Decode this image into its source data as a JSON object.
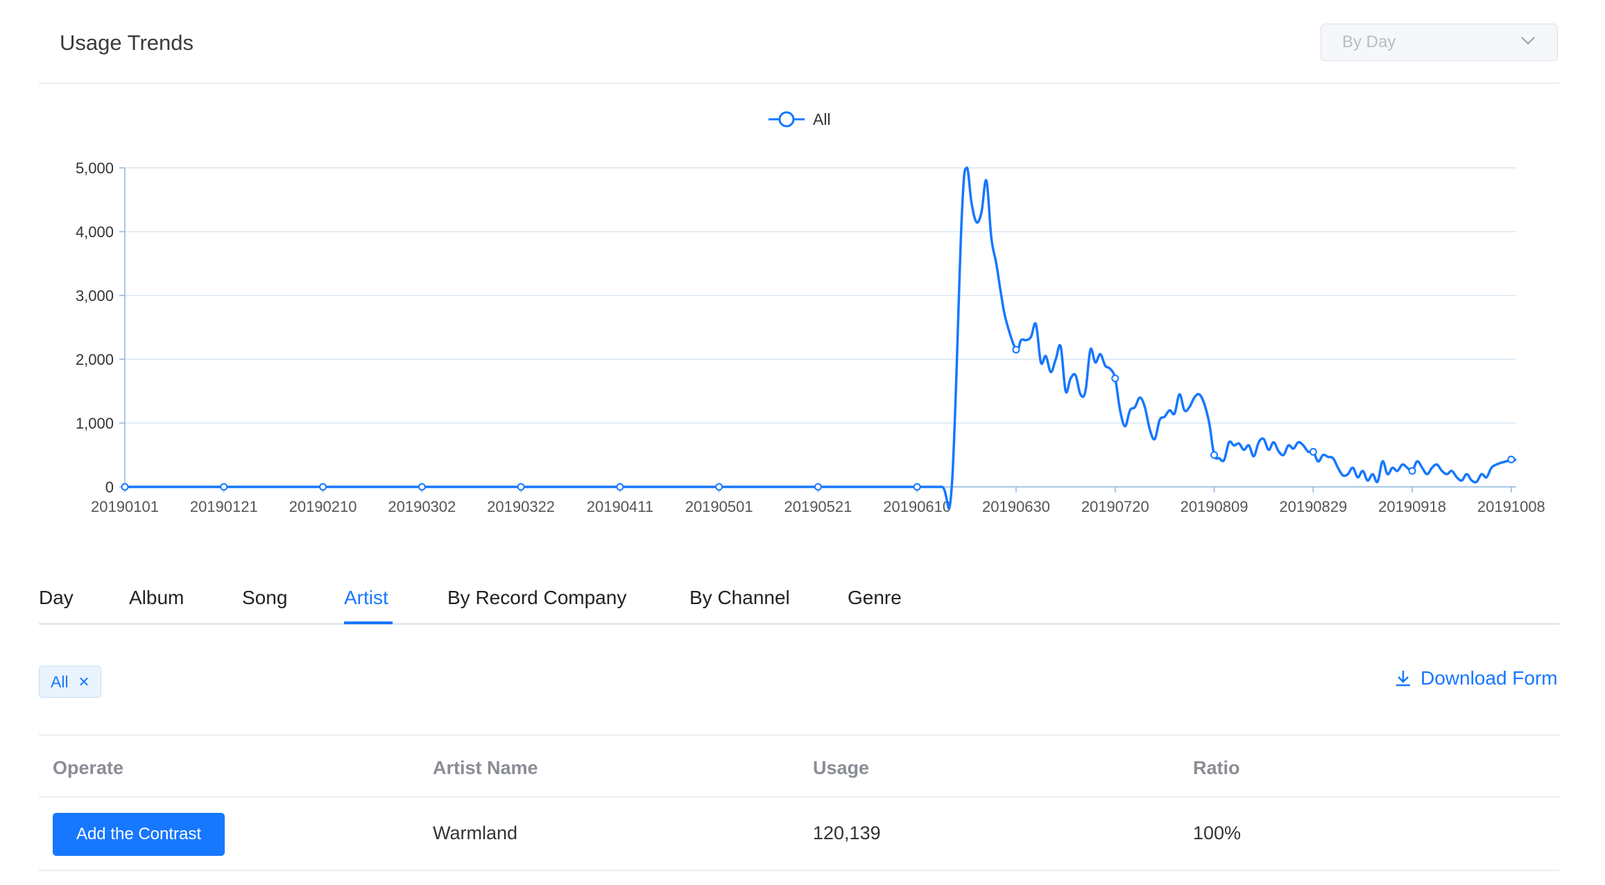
{
  "header": {
    "title": "Usage Trends",
    "period_select": {
      "value": "By Day",
      "icon": "chevron-down-icon"
    }
  },
  "chart_data": {
    "type": "line",
    "legend": [
      "All"
    ],
    "legend_position": "top-center",
    "series": [
      {
        "name": "All",
        "color": "#1677ff",
        "points": [
          [
            "20190101",
            0
          ],
          [
            "20190111",
            0
          ],
          [
            "20190121",
            0
          ],
          [
            "20190131",
            0
          ],
          [
            "20190210",
            0
          ],
          [
            "20190220",
            0
          ],
          [
            "20190302",
            0
          ],
          [
            "20190312",
            0
          ],
          [
            "20190322",
            0
          ],
          [
            "20190401",
            0
          ],
          [
            "20190411",
            0
          ],
          [
            "20190421",
            0
          ],
          [
            "20190501",
            0
          ],
          [
            "20190511",
            0
          ],
          [
            "20190521",
            0
          ],
          [
            "20190531",
            0
          ],
          [
            "20190610",
            0
          ],
          [
            "20190615",
            0
          ],
          [
            "20190617",
            0
          ],
          [
            "20190619",
            4200
          ],
          [
            "20190620",
            5000
          ],
          [
            "20190621",
            4450
          ],
          [
            "20190622",
            4150
          ],
          [
            "20190623",
            4300
          ],
          [
            "20190624",
            4800
          ],
          [
            "20190625",
            3900
          ],
          [
            "20190626",
            3500
          ],
          [
            "20190627",
            3000
          ],
          [
            "20190628",
            2600
          ],
          [
            "20190630",
            2150
          ],
          [
            "20190701",
            2300
          ],
          [
            "20190702",
            2300
          ],
          [
            "20190703",
            2350
          ],
          [
            "20190704",
            2550
          ],
          [
            "20190705",
            1950
          ],
          [
            "20190706",
            2050
          ],
          [
            "20190707",
            1800
          ],
          [
            "20190708",
            2000
          ],
          [
            "20190709",
            2200
          ],
          [
            "20190710",
            1500
          ],
          [
            "20190711",
            1700
          ],
          [
            "20190712",
            1750
          ],
          [
            "20190713",
            1450
          ],
          [
            "20190714",
            1500
          ],
          [
            "20190715",
            2150
          ],
          [
            "20190716",
            1950
          ],
          [
            "20190717",
            2080
          ],
          [
            "20190718",
            1900
          ],
          [
            "20190719",
            1850
          ],
          [
            "20190720",
            1700
          ],
          [
            "20190721",
            1200
          ],
          [
            "20190722",
            950
          ],
          [
            "20190723",
            1200
          ],
          [
            "20190724",
            1250
          ],
          [
            "20190725",
            1400
          ],
          [
            "20190726",
            1250
          ],
          [
            "20190727",
            900
          ],
          [
            "20190728",
            750
          ],
          [
            "20190729",
            1050
          ],
          [
            "20190730",
            1100
          ],
          [
            "20190731",
            1200
          ],
          [
            "20190801",
            1150
          ],
          [
            "20190802",
            1450
          ],
          [
            "20190803",
            1200
          ],
          [
            "20190804",
            1250
          ],
          [
            "20190805",
            1400
          ],
          [
            "20190806",
            1450
          ],
          [
            "20190807",
            1300
          ],
          [
            "20190808",
            1000
          ],
          [
            "20190809",
            500
          ],
          [
            "20190810",
            450
          ],
          [
            "20190811",
            420
          ],
          [
            "20190812",
            700
          ],
          [
            "20190813",
            650
          ],
          [
            "20190814",
            680
          ],
          [
            "20190815",
            580
          ],
          [
            "20190816",
            650
          ],
          [
            "20190817",
            480
          ],
          [
            "20190818",
            700
          ],
          [
            "20190819",
            750
          ],
          [
            "20190820",
            580
          ],
          [
            "20190821",
            700
          ],
          [
            "20190822",
            560
          ],
          [
            "20190823",
            500
          ],
          [
            "20190824",
            650
          ],
          [
            "20190825",
            600
          ],
          [
            "20190826",
            700
          ],
          [
            "20190827",
            650
          ],
          [
            "20190828",
            550
          ],
          [
            "20190829",
            550
          ],
          [
            "20190830",
            400
          ],
          [
            "20190831",
            500
          ],
          [
            "20190901",
            470
          ],
          [
            "20190902",
            450
          ],
          [
            "20190903",
            300
          ],
          [
            "20190904",
            180
          ],
          [
            "20190905",
            200
          ],
          [
            "20190906",
            300
          ],
          [
            "20190907",
            150
          ],
          [
            "20190908",
            250
          ],
          [
            "20190909",
            100
          ],
          [
            "20190910",
            200
          ],
          [
            "20190911",
            80
          ],
          [
            "20190912",
            400
          ],
          [
            "20190913",
            200
          ],
          [
            "20190914",
            300
          ],
          [
            "20190915",
            250
          ],
          [
            "20190916",
            350
          ],
          [
            "20190917",
            300
          ],
          [
            "20190918",
            250
          ],
          [
            "20190919",
            400
          ],
          [
            "20190920",
            300
          ],
          [
            "20190921",
            200
          ],
          [
            "20190922",
            300
          ],
          [
            "20190923",
            350
          ],
          [
            "20190924",
            250
          ],
          [
            "20190925",
            200
          ],
          [
            "20190926",
            250
          ],
          [
            "20190927",
            150
          ],
          [
            "20190928",
            100
          ],
          [
            "20190929",
            200
          ],
          [
            "20190930",
            100
          ],
          [
            "20191001",
            80
          ],
          [
            "20191002",
            200
          ],
          [
            "20191003",
            150
          ],
          [
            "20191004",
            300
          ],
          [
            "20191005",
            350
          ],
          [
            "20191006",
            380
          ],
          [
            "20191007",
            400
          ],
          [
            "20191008",
            430
          ],
          [
            "20191009",
            420
          ]
        ],
        "markers": [
          "20190101",
          "20190121",
          "20190210",
          "20190302",
          "20190322",
          "20190411",
          "20190501",
          "20190521",
          "20190610",
          "20190630",
          "20190720",
          "20190809",
          "20190829",
          "20190918",
          "20191008"
        ]
      }
    ],
    "x_ticks": [
      "20190101",
      "20190121",
      "20190210",
      "20190302",
      "20190322",
      "20190411",
      "20190501",
      "20190521",
      "20190610",
      "20190630",
      "20190720",
      "20190809",
      "20190829",
      "20190918",
      "20191008"
    ],
    "x_range": [
      "20190101",
      "20191009"
    ],
    "y_ticks": [
      0,
      1000,
      2000,
      3000,
      4000,
      5000
    ],
    "y_tick_labels": [
      "0",
      "1,000",
      "2,000",
      "3,000",
      "4,000",
      "5,000"
    ],
    "ylim": [
      0,
      5000
    ],
    "grid": true
  },
  "tabs": [
    {
      "label": "Day",
      "active": false
    },
    {
      "label": "Album",
      "active": false
    },
    {
      "label": "Song",
      "active": false
    },
    {
      "label": "Artist",
      "active": true
    },
    {
      "label": "By Record Company",
      "active": false
    },
    {
      "label": "By Channel",
      "active": false
    },
    {
      "label": "Genre",
      "active": false
    }
  ],
  "filter": {
    "tag": "All",
    "close_icon": "close-icon"
  },
  "download": {
    "label": "Download Form",
    "icon": "download-icon"
  },
  "table": {
    "headers": [
      "Operate",
      "Artist Name",
      "Usage",
      "Ratio"
    ],
    "rows": [
      {
        "action": "Add the Contrast",
        "artist": "Warmland",
        "usage": "120,139",
        "ratio": "100%"
      }
    ]
  }
}
